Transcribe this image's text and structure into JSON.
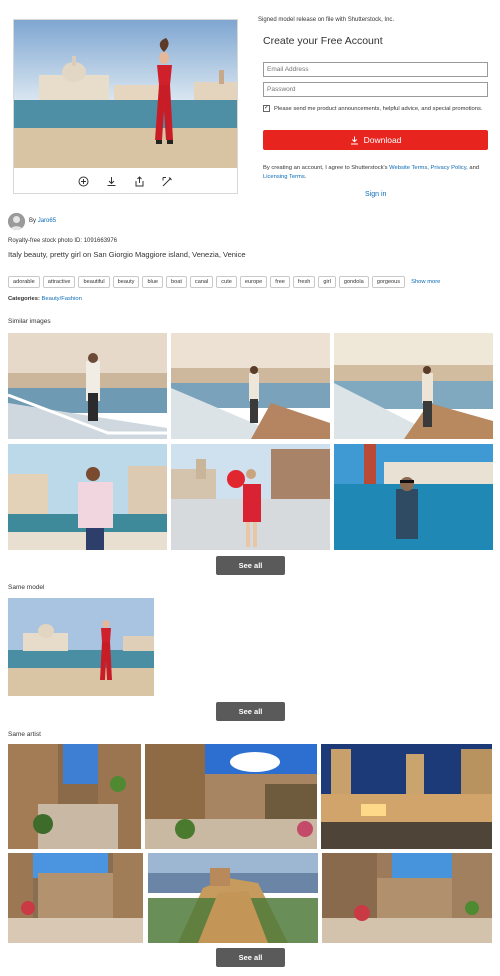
{
  "release_note": "Signed model release on file with Shutterstock, Inc.",
  "signup": {
    "title": "Create your Free Account",
    "email_placeholder": "Email Address",
    "password_placeholder": "Password",
    "checkbox_label": "Please send me product announcements, helpful advice, and special promotions.",
    "download_label": "Download",
    "terms_prefix": "By creating an account, I agree to Shutterstock's",
    "terms_link1": "Website Terms",
    "terms_link2": "Privacy Policy",
    "terms_and": ", and",
    "terms_link3": "Licensing Terms",
    "signin_label": "Sign in"
  },
  "photo": {
    "by_prefix": "By",
    "author": "Jaro65",
    "photo_id": "Royalty-free stock photo ID: 1091663976",
    "description": "Italy beauty, pretty girl on San Giorgio Maggiore island, Venezia, Venice",
    "tags": [
      "adorable",
      "attractive",
      "beautiful",
      "beauty",
      "blue",
      "boat",
      "canal",
      "cute",
      "europe",
      "free",
      "fresh",
      "girl",
      "gondola",
      "gorgeous"
    ],
    "show_more": "Show more",
    "categories_label": "Categories:",
    "categories_value": "Beauty/Fashion"
  },
  "sections": {
    "similar": "Similar images",
    "same_model": "Same model",
    "same_artist": "Same artist",
    "see_all": "See all"
  },
  "colors": {
    "download_red": "#e8241f",
    "link_blue": "#0b6bb6",
    "see_all_gray": "#5a5a5a"
  }
}
